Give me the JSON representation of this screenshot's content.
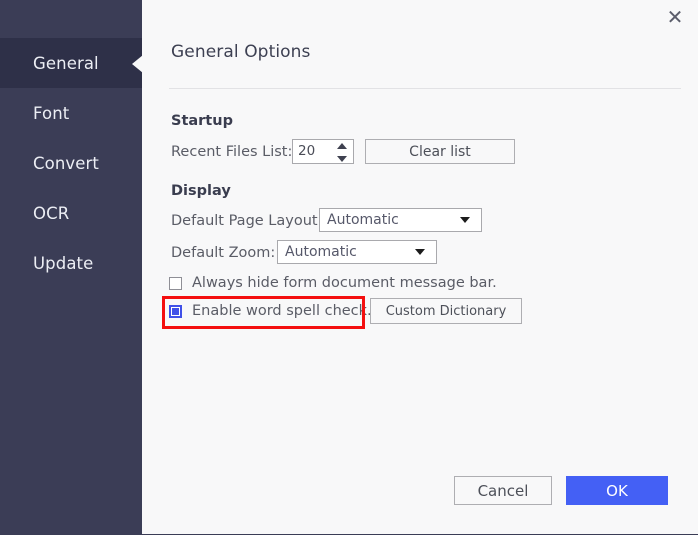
{
  "colors": {
    "sidebar_bg": "#3b3d56",
    "sidebar_active_bg": "#2e3048",
    "panel_bg": "#f8f8f9",
    "accent_blue": "#4460f5",
    "checkbox_blue": "#4050e8",
    "highlight_red": "#f40f0f"
  },
  "sidebar": {
    "items": [
      {
        "label": "General",
        "active": true
      },
      {
        "label": "Font",
        "active": false
      },
      {
        "label": "Convert",
        "active": false
      },
      {
        "label": "OCR",
        "active": false
      },
      {
        "label": "Update",
        "active": false
      }
    ]
  },
  "titlebar": {
    "close_glyph": "✕"
  },
  "panel": {
    "title": "General Options"
  },
  "startup": {
    "heading": "Startup",
    "recent_files_label": "Recent Files List:",
    "recent_files_value": "20",
    "clear_list_button": "Clear list"
  },
  "display": {
    "heading": "Display",
    "page_layout_label": "Default Page Layout:",
    "page_layout_value": "Automatic",
    "page_layout_options": [
      "Automatic"
    ],
    "zoom_label": "Default Zoom:",
    "zoom_value": "Automatic",
    "zoom_options": [
      "Automatic"
    ],
    "hide_message_bar_label": "Always hide form document message bar.",
    "hide_message_bar_checked": false,
    "spell_check_label": "Enable word spell check.",
    "spell_check_checked": true,
    "custom_dictionary_button": "Custom Dictionary"
  },
  "footer": {
    "cancel_label": "Cancel",
    "ok_label": "OK"
  }
}
